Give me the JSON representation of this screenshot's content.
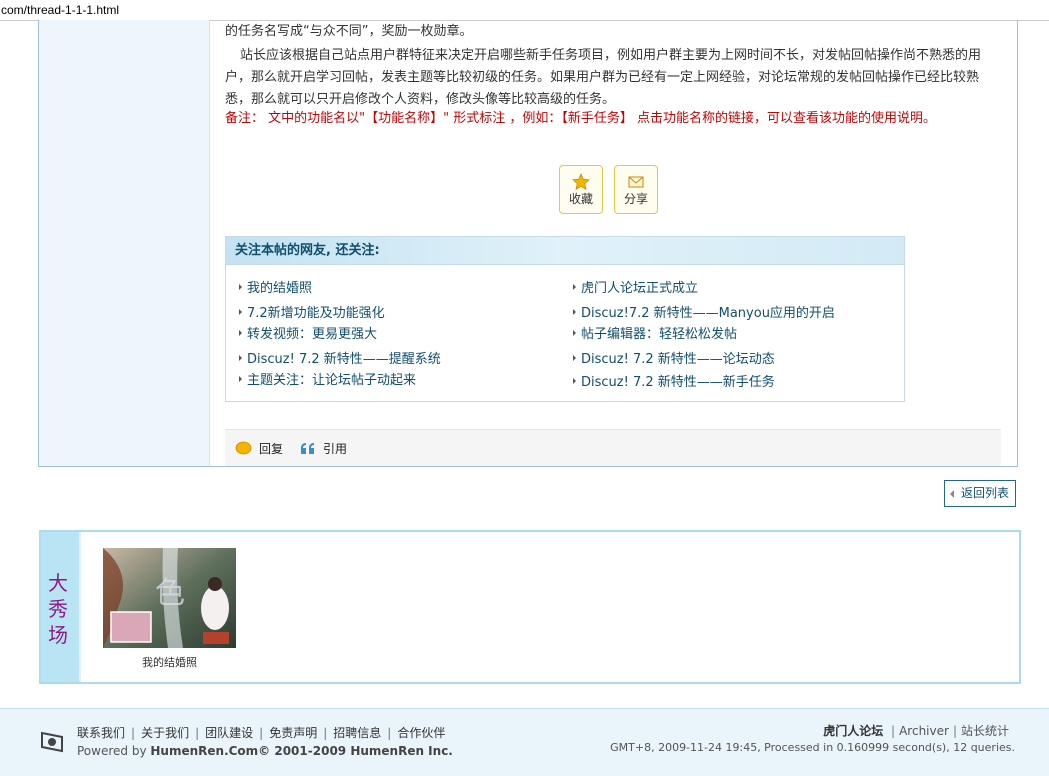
{
  "url": "com/thread-1-1-1.html",
  "post": {
    "paragraph1": "的任务名写成“与众不同”，奖励一枚勋章。",
    "paragraph2": "站长应该根据自己站点用户群特征来决定开启哪些新手任务项目，例如用户群主要为上网时间不长，对发帖回帖操作尚不熟悉的用户，那么就开启学习回帖，发表主题等比较初级的任务。如果用户群为已经有一定上网经验，对论坛常规的发帖回帖操作已经比较熟悉，那么就可以只开启修改个人资料，修改头像等比较高级的任务。",
    "note": "备注：  文中的功能名以\"【功能名称】\" 形式标注 ，例如：【新手任务】 点击功能名称的链接，可以查看该功能的使用说明。",
    "favorite_label": "收藏",
    "share_label": "分享"
  },
  "related": {
    "title": "关注本帖的网友, 还关注:",
    "left_items": [
      "我的结婚照",
      "7.2新增功能及功能强化",
      "转发视频：更易更强大",
      "Discuz! 7.2 新特性——提醒系统",
      "主题关注：让论坛帖子动起来"
    ],
    "right_items": [
      "虎门人论坛正式成立",
      "Discuz!7.2 新特性——Manyou应用的开启",
      "帖子编辑器：轻轻松松发帖",
      "Discuz! 7.2 新特性——论坛动态",
      "Discuz! 7.2 新特性——新手任务"
    ]
  },
  "actions": {
    "reply": "回复",
    "quote": "引用"
  },
  "back_to_list": "返回列表",
  "showcase": {
    "tag": "大秀场",
    "photo_caption": "我的结婚照"
  },
  "footer": {
    "links": [
      "联系我们",
      "关于我们",
      "团队建设",
      "免责声明",
      "招聘信息",
      "合作伙伴"
    ],
    "powered_prefix": "Powered by ",
    "powered_brand": "HumenRen.Com© 2001-2009 HumenRen Inc.",
    "site_name": "虎门人论坛",
    "archiver": "Archiver",
    "stats": "站长统计",
    "runtime": "GMT+8, 2009-11-24 19:45, Processed in 0.160999 second(s), 12 queries."
  },
  "colors": {
    "link": "#104f6e",
    "note": "#cc0000",
    "accent_border": "#a9dcef",
    "tag_text": "#8b1a8b"
  }
}
